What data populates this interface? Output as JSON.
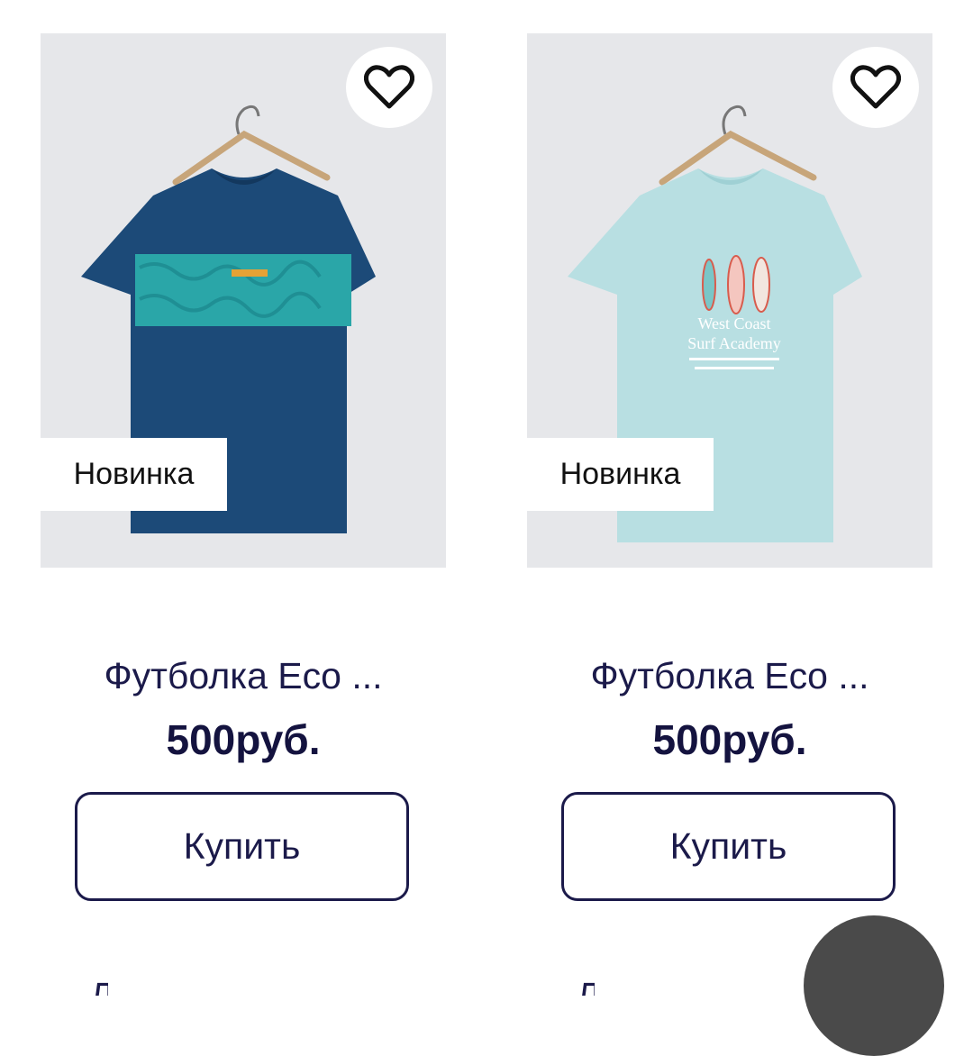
{
  "products": [
    {
      "badge": "Новинка",
      "title": "Футболка Eco ...",
      "price": "500руб.",
      "buy_label": "Купить",
      "shirt_color": "#1c4a78",
      "stripe_color": "#2aa6a8"
    },
    {
      "badge": "Новинка",
      "title": "Футболка Eco ...",
      "price": "500руб.",
      "buy_label": "Купить",
      "shirt_color": "#b8dfe2",
      "print_lines": [
        "West Coast",
        "Surf Academy"
      ]
    }
  ],
  "icons": {
    "favorite": "heart-outline-icon",
    "fab": "floating-action-button"
  },
  "colors": {
    "text_primary": "#1b1a4a",
    "image_bg": "#e6e7ea",
    "fab_bg": "#4a4a4a"
  }
}
